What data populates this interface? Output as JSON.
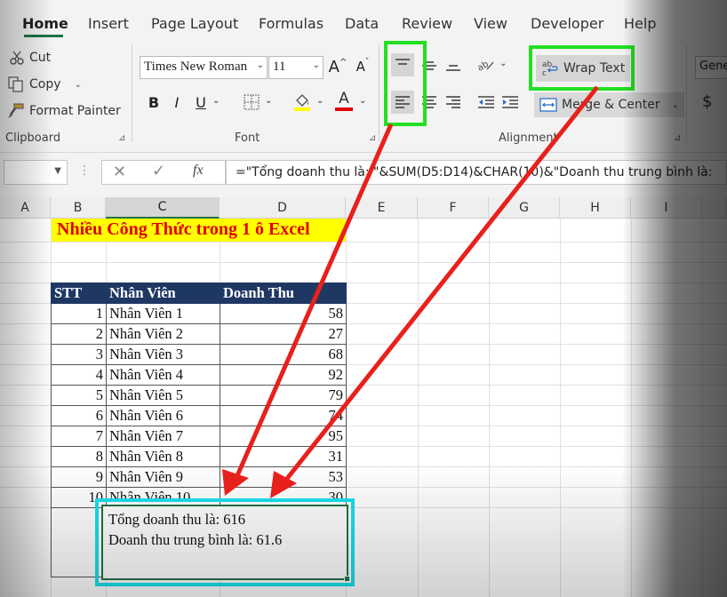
{
  "tabs": [
    "Home",
    "Insert",
    "Page Layout",
    "Formulas",
    "Data",
    "Review",
    "View",
    "Developer",
    "Help"
  ],
  "clipboard": {
    "cut_label": "Cut",
    "copy_label": "Copy",
    "format_painter_label": "Format Painter",
    "group_label": "Clipboard"
  },
  "font": {
    "name": "Times New Roman",
    "size": "11",
    "group_label": "Font",
    "increase_icon": "A",
    "decrease_icon": "A",
    "bold": "B",
    "italic": "I",
    "underline": "U",
    "font_color_glyph": "A"
  },
  "alignment": {
    "wrap_text_label": "Wrap Text",
    "merge_center_label": "Merge & Center",
    "group_label": "Alignment"
  },
  "number": {
    "format_label": "Gene",
    "currency_symbol": "$"
  },
  "formula_bar": {
    "fx_label": "fx",
    "formula": "=\"Tổng doanh thu là: \"&SUM(D5:D14)&CHAR(10)&\"Doanh thu trung bình là: "
  },
  "columns": [
    "A",
    "B",
    "C",
    "D",
    "E",
    "F",
    "G",
    "H",
    "I"
  ],
  "sheet": {
    "title": "Nhiều Công Thức trong 1 ô Excel",
    "headers": [
      "STT",
      "Nhân Viên",
      "Doanh Thu"
    ],
    "rows": [
      [
        "1",
        "Nhân Viên 1",
        "58"
      ],
      [
        "2",
        "Nhân Viên 2",
        "27"
      ],
      [
        "3",
        "Nhân Viên 3",
        "68"
      ],
      [
        "4",
        "Nhân Viên 4",
        "92"
      ],
      [
        "5",
        "Nhân Viên 5",
        "79"
      ],
      [
        "6",
        "Nhân Viên 6",
        "74"
      ],
      [
        "7",
        "Nhân Viên 7",
        "95"
      ],
      [
        "8",
        "Nhân Viên 8",
        "31"
      ],
      [
        "9",
        "Nhân Viên 9",
        "53"
      ],
      [
        "10",
        "Nhân Viên 10",
        "30"
      ]
    ],
    "result_line1": "Tổng doanh thu là: 616",
    "result_line2": "Doanh thu trung bình là: 61.6"
  },
  "colors": {
    "accent": "#217346",
    "highlight_green": "#21e021",
    "highlight_cyan": "#18e0ee",
    "arrow_red": "#e8201c",
    "header_fill": "#1f3763",
    "title_fill": "#ffff00",
    "title_text": "#e00000"
  }
}
